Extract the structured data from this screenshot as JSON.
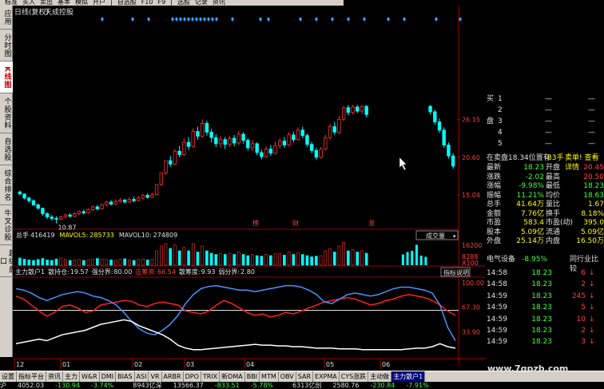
{
  "app": {
    "menu": [
      "标准",
      "买入",
      "卖出",
      "基本",
      "模拟",
      "开户",
      "|",
      "自选股",
      "F10",
      "F9",
      "|",
      "选股",
      "记录",
      "资讯"
    ],
    "title": "日线(复权)",
    "stock_name": "天成控股"
  },
  "side_tabs": [
    {
      "label": "应用",
      "active": false
    },
    {
      "label": "分时图",
      "active": false
    },
    {
      "label": "K线图",
      "active": true
    },
    {
      "label": "个股资料",
      "active": false
    },
    {
      "label": "自选股",
      "active": false
    },
    {
      "label": "综合排名",
      "active": false
    },
    {
      "label": "牛叉诊股",
      "active": false
    },
    {
      "label": "超级盘口",
      "active": false
    }
  ],
  "kline": {
    "price_labels": [
      "26.15",
      "20.60",
      "15.04"
    ],
    "low_marker": "10.87",
    "event_markers": [
      "榜",
      "财",
      "涨"
    ],
    "colors": {
      "up": "#ff3030",
      "down": "#00ffff"
    },
    "candles": [
      [
        15.5,
        15.2,
        15.7,
        15.0
      ],
      [
        15.2,
        14.6,
        15.3,
        14.4
      ],
      [
        14.6,
        14.2,
        14.8,
        13.9
      ],
      [
        14.2,
        13.6,
        14.4,
        13.4
      ],
      [
        13.6,
        13.1,
        13.8,
        12.9
      ],
      [
        13.1,
        12.3,
        13.2,
        12.0
      ],
      [
        12.3,
        11.8,
        12.5,
        11.5
      ],
      [
        11.8,
        11.6,
        12.1,
        11.3
      ],
      [
        11.6,
        11.5,
        11.9,
        10.87
      ],
      [
        11.5,
        11.8,
        12.0,
        11.3
      ],
      [
        11.8,
        12.1,
        12.3,
        11.6
      ],
      [
        12.1,
        11.9,
        12.4,
        11.7
      ],
      [
        11.9,
        12.3,
        12.5,
        11.8
      ],
      [
        12.3,
        12.6,
        12.8,
        12.1
      ],
      [
        12.6,
        12.4,
        12.9,
        12.2
      ],
      [
        12.4,
        12.9,
        13.1,
        12.3
      ],
      [
        12.9,
        13.3,
        13.5,
        12.7
      ],
      [
        13.3,
        13.0,
        13.6,
        12.8
      ],
      [
        13.0,
        13.6,
        13.8,
        12.9
      ],
      [
        13.6,
        14.0,
        14.2,
        13.4
      ],
      [
        14.0,
        13.7,
        14.3,
        13.5
      ],
      [
        13.7,
        14.1,
        14.4,
        13.6
      ],
      [
        14.1,
        14.3,
        14.6,
        13.9
      ],
      [
        14.3,
        14.0,
        14.5,
        13.8
      ],
      [
        14.0,
        14.4,
        14.7,
        13.9
      ],
      [
        14.4,
        14.2,
        14.8,
        14.0
      ],
      [
        14.2,
        14.6,
        14.9,
        14.1
      ],
      [
        14.6,
        15.0,
        15.2,
        14.4
      ],
      [
        15.0,
        14.7,
        15.3,
        14.5
      ],
      [
        14.7,
        15.1,
        15.4,
        14.6
      ],
      [
        15.1,
        16.6,
        16.6,
        15.0
      ],
      [
        16.6,
        18.3,
        18.3,
        16.4
      ],
      [
        18.3,
        20.1,
        20.1,
        18.0
      ],
      [
        20.1,
        19.6,
        20.8,
        19.2
      ],
      [
        19.6,
        21.5,
        21.8,
        19.5
      ],
      [
        21.5,
        21.0,
        22.3,
        20.6
      ],
      [
        21.0,
        22.8,
        23.4,
        20.8
      ],
      [
        22.8,
        22.2,
        23.6,
        21.7
      ],
      [
        22.2,
        24.4,
        24.9,
        22.0
      ],
      [
        24.4,
        23.7,
        25.1,
        23.2
      ],
      [
        23.7,
        25.6,
        26.2,
        23.5
      ],
      [
        25.6,
        24.3,
        26.0,
        23.8
      ],
      [
        24.3,
        23.5,
        24.8,
        22.8
      ],
      [
        23.5,
        22.6,
        24.0,
        22.1
      ],
      [
        22.6,
        23.2,
        23.7,
        22.0
      ],
      [
        23.2,
        22.5,
        23.6,
        21.8
      ],
      [
        22.5,
        23.4,
        23.8,
        22.1
      ],
      [
        23.4,
        22.7,
        23.9,
        22.2
      ],
      [
        22.7,
        24.0,
        24.5,
        22.4
      ],
      [
        24.0,
        23.1,
        24.3,
        22.6
      ],
      [
        23.1,
        22.0,
        23.4,
        21.6
      ],
      [
        22.0,
        22.6,
        23.1,
        21.5
      ],
      [
        22.6,
        21.3,
        22.8,
        20.9
      ],
      [
        21.3,
        20.7,
        21.7,
        20.3
      ],
      [
        20.7,
        21.8,
        22.2,
        20.5
      ],
      [
        21.8,
        21.2,
        22.4,
        20.8
      ],
      [
        21.2,
        22.3,
        22.9,
        21.0
      ],
      [
        22.3,
        23.0,
        23.4,
        21.9
      ],
      [
        23.0,
        22.4,
        23.6,
        22.0
      ],
      [
        22.4,
        23.9,
        24.3,
        22.2
      ],
      [
        23.9,
        23.2,
        24.4,
        22.8
      ],
      [
        23.2,
        24.6,
        25.0,
        23.0
      ],
      [
        24.6,
        23.8,
        25.1,
        23.4
      ],
      [
        23.8,
        22.5,
        24.1,
        22.1
      ],
      [
        22.5,
        21.6,
        22.9,
        21.2
      ],
      [
        21.6,
        20.6,
        22.0,
        20.2
      ],
      [
        20.6,
        21.8,
        22.1,
        20.4
      ],
      [
        21.8,
        23.5,
        23.9,
        21.6
      ],
      [
        23.5,
        25.1,
        25.5,
        23.2
      ],
      [
        25.1,
        24.3,
        25.8,
        23.9
      ],
      [
        24.3,
        26.2,
        26.7,
        24.0
      ],
      [
        26.2,
        27.9,
        28.1,
        25.9
      ],
      [
        27.9,
        27.2,
        28.3,
        26.8
      ],
      [
        27.2,
        28.0,
        28.3,
        26.9
      ],
      [
        28.0,
        27.4,
        28.3,
        27.1
      ],
      [
        27.4,
        28.1,
        28.3,
        27.0
      ],
      [
        28.1,
        26.9,
        28.3,
        26.5
      ],
      null,
      null,
      null,
      null,
      null,
      null,
      null,
      null,
      null,
      null,
      null,
      null,
      null,
      [
        28.1,
        27.3,
        28.3,
        26.9
      ],
      [
        27.3,
        25.8,
        27.6,
        25.4
      ],
      [
        25.8,
        24.6,
        26.3,
        24.2
      ],
      [
        24.6,
        22.4,
        25.0,
        22.0
      ],
      [
        22.4,
        20.8,
        22.8,
        20.4
      ],
      [
        20.8,
        19.3,
        21.2,
        18.9
      ]
    ]
  },
  "volume": {
    "label": "总手",
    "value": "416419",
    "ma5_label": "MAVOL5:",
    "ma5_value": "285733",
    "ma10_label": "MAVOL10:",
    "ma10_value": "274809",
    "dropdown": "成交量",
    "axis": [
      "16200",
      "8288",
      "X100"
    ]
  },
  "indicator": {
    "name": "主力散户1",
    "line1_label": "散持仓:",
    "line1_value": "19.57",
    "line2_label": "强分界:",
    "line2_value": "80.00",
    "line3_label": "庄筹资:",
    "line3_value": "66.54",
    "line4_label": "散筹度:",
    "line4_value": "9.93",
    "line5_label": "弱分界:",
    "line5_value": "2.80",
    "help_button": "指标说明",
    "axis": [
      "100.00",
      "67.30",
      "33.90"
    ]
  },
  "x_axis": [
    "12",
    "01",
    "02",
    "03",
    "04",
    "05",
    "06"
  ],
  "quote_panel": {
    "orderbook": [
      {
        "side": "买",
        "idx": "1",
        "price": "—",
        "vol": "—"
      },
      {
        "side": "",
        "idx": "2",
        "price": "—",
        "vol": "—"
      },
      {
        "side": "盘",
        "idx": "3",
        "price": "—",
        "vol": "—"
      },
      {
        "side": "",
        "idx": "4",
        "price": "—",
        "vol": "—"
      },
      {
        "side": "",
        "idx": "5",
        "price": "—",
        "vol": "—"
      }
    ],
    "summary": "在卖盘18.34位置有",
    "summary_vol": "83手",
    "summary_link": "卖单! 查看详情",
    "stats": [
      [
        "最新",
        "18.23",
        "开盘",
        "20.45"
      ],
      [
        "涨跌",
        "-2.02",
        "最高",
        "20.50"
      ],
      [
        "涨幅",
        "-9.98%",
        "最低",
        "18.23"
      ],
      [
        "振幅",
        "11.21%",
        "均价",
        "18.63"
      ],
      [
        "总手",
        "41.64万",
        "量比",
        "1.67"
      ],
      [
        "金额",
        "7.76亿",
        "换手",
        "8.18%"
      ],
      [
        "市盈",
        "583.4",
        "市盈(动)",
        "395.0"
      ],
      [
        "股本",
        "5.09亿",
        "流通",
        "5.09亿"
      ],
      [
        "外盘",
        "25.14万",
        "内盘",
        "16.50万"
      ]
    ],
    "sector": "电气设备",
    "sector_change": "-8.95%",
    "sector_compare": "同行业比较",
    "ticks": [
      [
        "14:58",
        "18.23",
        "6"
      ],
      [
        "14:58",
        "18.23",
        "2"
      ],
      [
        "14:59",
        "18.23",
        "245"
      ],
      [
        "14:59",
        "18.23",
        "5"
      ],
      [
        "14:59",
        "18.23",
        "10"
      ],
      [
        "14:59",
        "18.23",
        "2"
      ],
      [
        "14:59",
        "18.23",
        "3"
      ]
    ]
  },
  "bottom_tabs": [
    {
      "label": "设置",
      "active": false
    },
    {
      "label": "指标平台",
      "active": false
    },
    {
      "label": "资讯",
      "active": false
    },
    {
      "label": "主力",
      "active": false
    },
    {
      "label": "W&R",
      "active": false
    },
    {
      "label": "DMI",
      "active": false
    },
    {
      "label": "BIAS",
      "active": false
    },
    {
      "label": "ASI",
      "active": false
    },
    {
      "label": "VR",
      "active": false
    },
    {
      "label": "ARBR",
      "active": false
    },
    {
      "label": "DPO",
      "active": false
    },
    {
      "label": "TRIX",
      "active": false
    },
    {
      "label": "新DMA",
      "active": false
    },
    {
      "label": "BBI",
      "active": false
    },
    {
      "label": "MTM",
      "active": false
    },
    {
      "label": "OBV",
      "active": false
    },
    {
      "label": "SAR",
      "active": false
    },
    {
      "label": "EXPMA",
      "active": false
    },
    {
      "label": "CYS涨跌",
      "active": false
    },
    {
      "label": "主动做",
      "active": false
    },
    {
      "label": "主力散户1",
      "active": true
    }
  ],
  "status_bar": [
    "沪",
    "4052.03",
    "-130.94",
    "-3.74%",
    "8943亿深",
    "13566.37",
    "-833.51",
    "-5.78%",
    "6313亿创",
    "2580.76",
    "-230.84",
    "-7.91%"
  ],
  "watermark": "www.7gpzb.com"
}
